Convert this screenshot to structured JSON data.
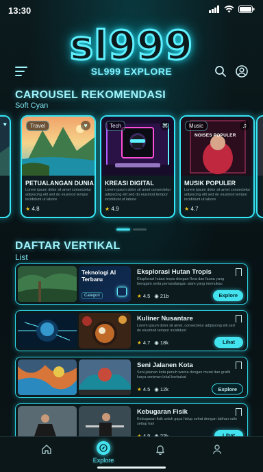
{
  "status": {
    "time": "13:30"
  },
  "brand": {
    "logo": "sl999",
    "title": "SL999 EXPLORE"
  },
  "carousel": {
    "title": "CAROUSEL REKOMENDASI",
    "subtitle": "Soft Cyan",
    "cards": [
      {
        "tag": "Travel",
        "title": "PETUALANGAN DUNIA",
        "desc": "Lorem ipsum dolor sit amet consectetur adipiscing elit sed do eiusmod tempor incididunt ut labore",
        "rating": "4.8",
        "icon": "heart-icon"
      },
      {
        "tag": "Tech",
        "title": "KREASI DIGITAL",
        "desc": "Lorem ipsum dolor sit amet consectetur adipiscing elit sed do eiusmod tempor incididunt ut labore",
        "rating": "4.9",
        "icon": "gamepad-icon"
      },
      {
        "tag": "Music",
        "title": "MUSIK POPULER",
        "desc": "Lorem ipsum dolor sit amet consectetur adipiscing elit sed do eiusmod tempor incididunt ut labore",
        "rating": "4.7",
        "icon": "music-note-icon",
        "poster_text": "NOISES POPULER"
      }
    ],
    "active_page": 1,
    "page_count": 2
  },
  "vertical": {
    "title": "DAFTAR VERTIKAL",
    "subtitle": "List",
    "items": [
      {
        "title": "Eksplorasi Hutan Tropis",
        "desc": "Eksplorasi hutan tropis dengan flora dan fauna yang beragam serta pemandangan alam yang memukau",
        "rating": "4.5",
        "views": "21b",
        "button": "Explore",
        "button_style": "filled",
        "thumb_label": "Teknologi AI Terbaru",
        "thumb_caption": "Categori"
      },
      {
        "title": "Kuliner Nusantare",
        "desc": "Lorem ipsum dolor sit amet, consectetur adipiscing elit sed do eiusmod tempor incididunt",
        "rating": "4.7",
        "views": "18k",
        "button": "Lihat",
        "button_style": "filled"
      },
      {
        "title": "Seni Jalanen Kota",
        "desc": "Seni jalanan kota penuh warna dengan mural dan grafiti karya seniman lokal berbakat",
        "rating": "4.5",
        "views": "12k",
        "button": "Explore",
        "button_style": "outline"
      },
      {
        "title": "Kebugaran Fisik",
        "desc": "Kebugaran fisik untuk gaya hidup sehat dengan latihan rutin setiap hari",
        "rating": "4.9",
        "views": "23k",
        "button": "Lihat",
        "button_style": "filled"
      }
    ]
  },
  "nav": {
    "explore_label": "Explore"
  },
  "colors": {
    "accent": "#42e2ef",
    "background": "#0a1417",
    "star": "#f5c518"
  }
}
